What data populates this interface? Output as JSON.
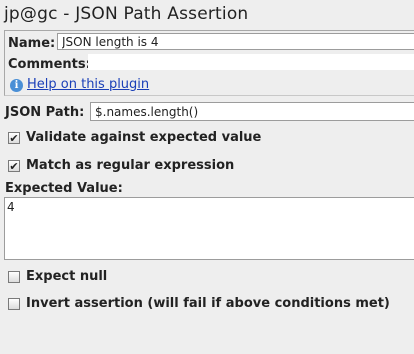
{
  "title": "jp@gc - JSON Path Assertion",
  "name_label": "Name:",
  "name_value": "JSON length is 4",
  "comments_label": "Comments:",
  "comments_value": "",
  "help_icon": "info-icon",
  "help_link": "Help on this plugin",
  "json_path_label": "JSON Path:",
  "json_path_value": "$.names.length()",
  "checkboxes": [
    {
      "label": "Validate against expected value",
      "checked": true
    },
    {
      "label": "Match as regular expression",
      "checked": true
    },
    {
      "label": "Expect null",
      "checked": false
    },
    {
      "label": "Invert assertion (will fail if above conditions met)",
      "checked": false
    }
  ],
  "expected_label": "Expected Value:",
  "expected_value": "4",
  "colors": {
    "link": "#1a3fb8",
    "background": "#eeeeee"
  }
}
